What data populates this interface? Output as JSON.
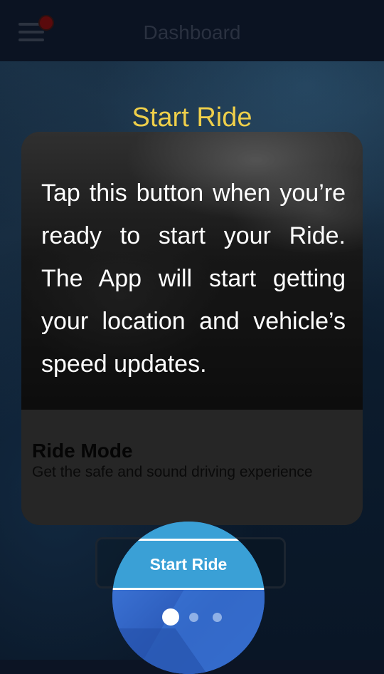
{
  "header": {
    "title": "Dashboard"
  },
  "spotlight": {
    "title": "Start Ride",
    "description": "Tap this button when you’re ready to start your Ride. The App will start getting your location and vehicle’s speed updates."
  },
  "ride_card": {
    "title": "Ride Mode",
    "subtitle": "Get the safe and sound driving experience"
  },
  "start_button": {
    "label": "Start Ride"
  },
  "pager": {
    "total": 3,
    "active_index": 0
  },
  "colors": {
    "accent_yellow": "#efcf4a",
    "button_blue": "#3aa0d6",
    "spotlight_blue": "#2f63c2",
    "notification_dot": "#5a0a0c"
  }
}
